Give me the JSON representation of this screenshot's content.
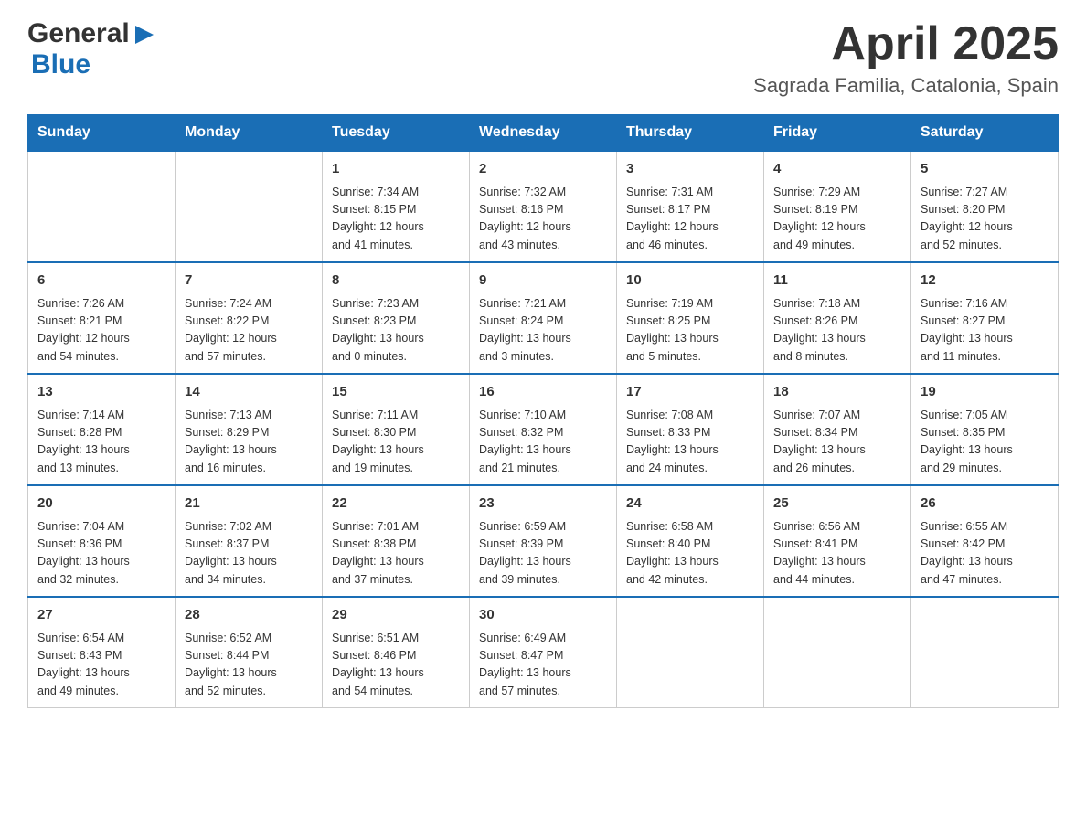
{
  "logo": {
    "general": "General",
    "blue": "Blue"
  },
  "header": {
    "title": "April 2025",
    "subtitle": "Sagrada Familia, Catalonia, Spain"
  },
  "weekdays": [
    "Sunday",
    "Monday",
    "Tuesday",
    "Wednesday",
    "Thursday",
    "Friday",
    "Saturday"
  ],
  "weeks": [
    [
      {
        "day": "",
        "info": ""
      },
      {
        "day": "",
        "info": ""
      },
      {
        "day": "1",
        "info": "Sunrise: 7:34 AM\nSunset: 8:15 PM\nDaylight: 12 hours\nand 41 minutes."
      },
      {
        "day": "2",
        "info": "Sunrise: 7:32 AM\nSunset: 8:16 PM\nDaylight: 12 hours\nand 43 minutes."
      },
      {
        "day": "3",
        "info": "Sunrise: 7:31 AM\nSunset: 8:17 PM\nDaylight: 12 hours\nand 46 minutes."
      },
      {
        "day": "4",
        "info": "Sunrise: 7:29 AM\nSunset: 8:19 PM\nDaylight: 12 hours\nand 49 minutes."
      },
      {
        "day": "5",
        "info": "Sunrise: 7:27 AM\nSunset: 8:20 PM\nDaylight: 12 hours\nand 52 minutes."
      }
    ],
    [
      {
        "day": "6",
        "info": "Sunrise: 7:26 AM\nSunset: 8:21 PM\nDaylight: 12 hours\nand 54 minutes."
      },
      {
        "day": "7",
        "info": "Sunrise: 7:24 AM\nSunset: 8:22 PM\nDaylight: 12 hours\nand 57 minutes."
      },
      {
        "day": "8",
        "info": "Sunrise: 7:23 AM\nSunset: 8:23 PM\nDaylight: 13 hours\nand 0 minutes."
      },
      {
        "day": "9",
        "info": "Sunrise: 7:21 AM\nSunset: 8:24 PM\nDaylight: 13 hours\nand 3 minutes."
      },
      {
        "day": "10",
        "info": "Sunrise: 7:19 AM\nSunset: 8:25 PM\nDaylight: 13 hours\nand 5 minutes."
      },
      {
        "day": "11",
        "info": "Sunrise: 7:18 AM\nSunset: 8:26 PM\nDaylight: 13 hours\nand 8 minutes."
      },
      {
        "day": "12",
        "info": "Sunrise: 7:16 AM\nSunset: 8:27 PM\nDaylight: 13 hours\nand 11 minutes."
      }
    ],
    [
      {
        "day": "13",
        "info": "Sunrise: 7:14 AM\nSunset: 8:28 PM\nDaylight: 13 hours\nand 13 minutes."
      },
      {
        "day": "14",
        "info": "Sunrise: 7:13 AM\nSunset: 8:29 PM\nDaylight: 13 hours\nand 16 minutes."
      },
      {
        "day": "15",
        "info": "Sunrise: 7:11 AM\nSunset: 8:30 PM\nDaylight: 13 hours\nand 19 minutes."
      },
      {
        "day": "16",
        "info": "Sunrise: 7:10 AM\nSunset: 8:32 PM\nDaylight: 13 hours\nand 21 minutes."
      },
      {
        "day": "17",
        "info": "Sunrise: 7:08 AM\nSunset: 8:33 PM\nDaylight: 13 hours\nand 24 minutes."
      },
      {
        "day": "18",
        "info": "Sunrise: 7:07 AM\nSunset: 8:34 PM\nDaylight: 13 hours\nand 26 minutes."
      },
      {
        "day": "19",
        "info": "Sunrise: 7:05 AM\nSunset: 8:35 PM\nDaylight: 13 hours\nand 29 minutes."
      }
    ],
    [
      {
        "day": "20",
        "info": "Sunrise: 7:04 AM\nSunset: 8:36 PM\nDaylight: 13 hours\nand 32 minutes."
      },
      {
        "day": "21",
        "info": "Sunrise: 7:02 AM\nSunset: 8:37 PM\nDaylight: 13 hours\nand 34 minutes."
      },
      {
        "day": "22",
        "info": "Sunrise: 7:01 AM\nSunset: 8:38 PM\nDaylight: 13 hours\nand 37 minutes."
      },
      {
        "day": "23",
        "info": "Sunrise: 6:59 AM\nSunset: 8:39 PM\nDaylight: 13 hours\nand 39 minutes."
      },
      {
        "day": "24",
        "info": "Sunrise: 6:58 AM\nSunset: 8:40 PM\nDaylight: 13 hours\nand 42 minutes."
      },
      {
        "day": "25",
        "info": "Sunrise: 6:56 AM\nSunset: 8:41 PM\nDaylight: 13 hours\nand 44 minutes."
      },
      {
        "day": "26",
        "info": "Sunrise: 6:55 AM\nSunset: 8:42 PM\nDaylight: 13 hours\nand 47 minutes."
      }
    ],
    [
      {
        "day": "27",
        "info": "Sunrise: 6:54 AM\nSunset: 8:43 PM\nDaylight: 13 hours\nand 49 minutes."
      },
      {
        "day": "28",
        "info": "Sunrise: 6:52 AM\nSunset: 8:44 PM\nDaylight: 13 hours\nand 52 minutes."
      },
      {
        "day": "29",
        "info": "Sunrise: 6:51 AM\nSunset: 8:46 PM\nDaylight: 13 hours\nand 54 minutes."
      },
      {
        "day": "30",
        "info": "Sunrise: 6:49 AM\nSunset: 8:47 PM\nDaylight: 13 hours\nand 57 minutes."
      },
      {
        "day": "",
        "info": ""
      },
      {
        "day": "",
        "info": ""
      },
      {
        "day": "",
        "info": ""
      }
    ]
  ]
}
